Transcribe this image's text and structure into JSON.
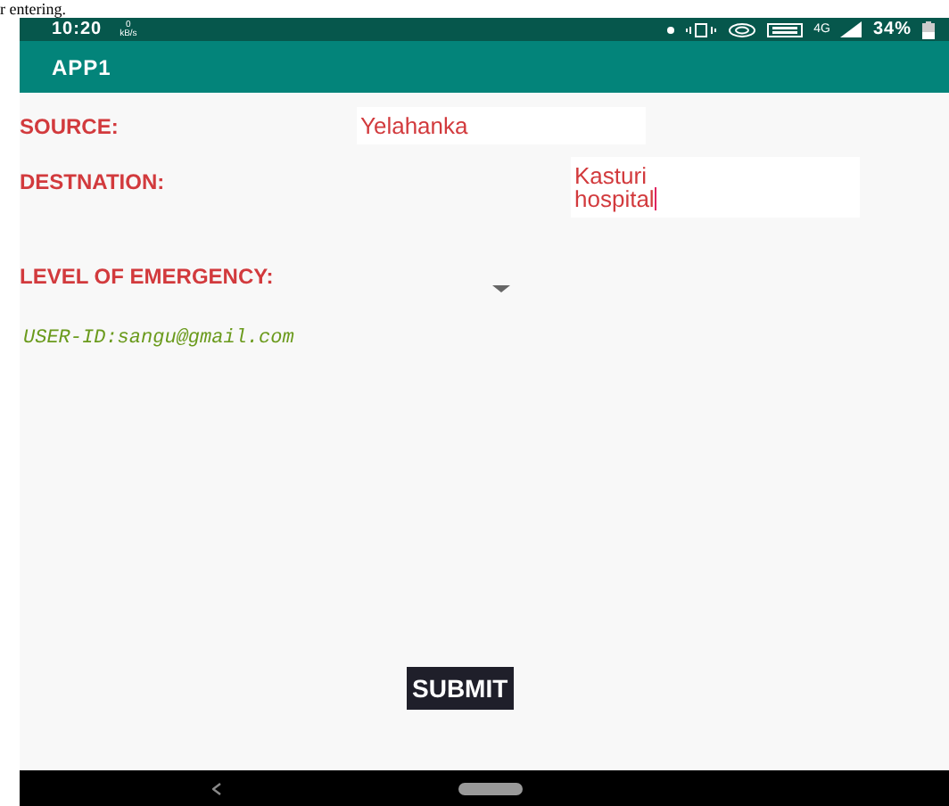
{
  "document_text": "r entering.",
  "status_bar": {
    "time": "10:20",
    "net_speed": "0",
    "net_speed_unit": "kB/s",
    "network": "4G",
    "battery": "34%"
  },
  "app_bar": {
    "title": "APP1"
  },
  "form": {
    "fields": [
      {
        "kind": "text",
        "label": "SOURCE:",
        "value": "Yelahanka",
        "focused": false
      },
      {
        "kind": "text",
        "label": "DESTNATION:",
        "value": "Kasturi hospital",
        "focused": true
      },
      {
        "kind": "dropdown",
        "label": "LEVEL OF EMERGENCY:"
      }
    ],
    "user_id": "USER-ID:sangu@gmail.com",
    "submit": "SUBMIT"
  }
}
